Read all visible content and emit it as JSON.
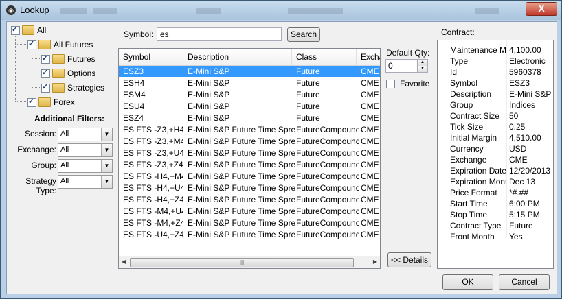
{
  "window": {
    "title": "Lookup",
    "close_label": "X"
  },
  "tree": {
    "items": [
      {
        "label": "All",
        "checked": true
      },
      {
        "label": "All Futures",
        "checked": true
      },
      {
        "label": "Futures",
        "checked": true
      },
      {
        "label": "Options",
        "checked": true
      },
      {
        "label": "Strategies",
        "checked": true
      },
      {
        "label": "Forex",
        "checked": true
      }
    ]
  },
  "filters": {
    "title": "Additional Filters:",
    "session": {
      "label": "Session:",
      "value": "All"
    },
    "exchange": {
      "label": "Exchange:",
      "value": "All"
    },
    "group": {
      "label": "Group:",
      "value": "All"
    },
    "strategy_type": {
      "label": "Strategy Type:",
      "value": "All"
    }
  },
  "search": {
    "label": "Symbol:",
    "value": "es",
    "button": "Search"
  },
  "grid": {
    "columns": [
      "Symbol",
      "Description",
      "Class",
      "Exchange"
    ],
    "rows": [
      [
        "ESZ3",
        "E-Mini S&P",
        "Future",
        "CME"
      ],
      [
        "ESH4",
        "E-Mini S&P",
        "Future",
        "CME"
      ],
      [
        "ESM4",
        "E-Mini S&P",
        "Future",
        "CME"
      ],
      [
        "ESU4",
        "E-Mini S&P",
        "Future",
        "CME"
      ],
      [
        "ESZ4",
        "E-Mini S&P",
        "Future",
        "CME"
      ],
      [
        "ES FTS -Z3,+H4",
        "E-Mini S&P Future Time Spread",
        "FutureCompound",
        "CME"
      ],
      [
        "ES FTS -Z3,+M4",
        "E-Mini S&P Future Time Spread",
        "FutureCompound",
        "CME"
      ],
      [
        "ES FTS -Z3,+U4",
        "E-Mini S&P Future Time Spread",
        "FutureCompound",
        "CME"
      ],
      [
        "ES FTS -Z3,+Z4",
        "E-Mini S&P Future Time Spread",
        "FutureCompound",
        "CME"
      ],
      [
        "ES FTS -H4,+M4",
        "E-Mini S&P Future Time Spread",
        "FutureCompound",
        "CME"
      ],
      [
        "ES FTS -H4,+U4",
        "E-Mini S&P Future Time Spread",
        "FutureCompound",
        "CME"
      ],
      [
        "ES FTS -H4,+Z4",
        "E-Mini S&P Future Time Spread",
        "FutureCompound",
        "CME"
      ],
      [
        "ES FTS -M4,+U4",
        "E-Mini S&P Future Time Spread",
        "FutureCompound",
        "CME"
      ],
      [
        "ES FTS -M4,+Z4",
        "E-Mini S&P Future Time Spread",
        "FutureCompound",
        "CME"
      ],
      [
        "ES FTS -U4,+Z4",
        "E-Mini S&P Future Time Spread",
        "FutureCompound",
        "CME"
      ]
    ],
    "selected_row": 0
  },
  "quantity": {
    "label": "Default Qty:",
    "value": "0"
  },
  "favorite": {
    "label": "Favorite",
    "checked": false
  },
  "details_button": "<< Details",
  "contract": {
    "label": "Contract:",
    "fields": [
      [
        "Maintenance Margin",
        "4,100.00"
      ],
      [
        "Type",
        "Electronic"
      ],
      [
        "Id",
        "5960378"
      ],
      [
        "Symbol",
        "ESZ3"
      ],
      [
        "Description",
        "E-Mini S&P"
      ],
      [
        "Group",
        "Indices"
      ],
      [
        "Contract Size",
        "50"
      ],
      [
        "Tick Size",
        "0.25"
      ],
      [
        "Initial Margin",
        "4,510.00"
      ],
      [
        "Currency",
        "USD"
      ],
      [
        "Exchange",
        "CME"
      ],
      [
        "Expiration Date",
        "12/20/2013"
      ],
      [
        "Expiration Month",
        "Dec 13"
      ],
      [
        "Price Format",
        "*#.##"
      ],
      [
        "Start Time",
        "6:00 PM"
      ],
      [
        "Stop Time",
        "5:15 PM"
      ],
      [
        "Contract Type",
        "Future"
      ],
      [
        "Front Month",
        "Yes"
      ]
    ]
  },
  "footer": {
    "ok": "OK",
    "cancel": "Cancel"
  },
  "colors": {
    "selection": "#3399ff",
    "titlebar": "#b9d0e6",
    "close": "#c0392b"
  }
}
